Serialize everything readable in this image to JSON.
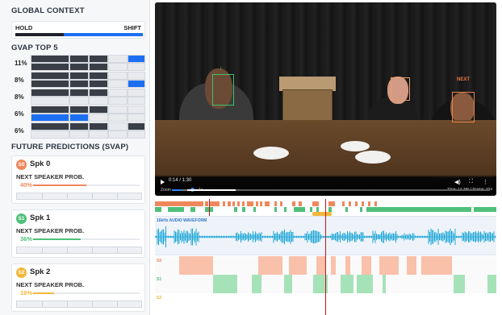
{
  "left_panel": {
    "global_context": {
      "title": "GLOBAL CONTEXT",
      "hold_label": "HOLD",
      "shift_label": "SHIFT",
      "shift_fraction": 0.62
    },
    "gvap": {
      "title": "GVAP TOP 5",
      "rows": [
        {
          "pct": "11%"
        },
        {
          "pct": "8%"
        },
        {
          "pct": "8%"
        },
        {
          "pct": "6%"
        },
        {
          "pct": "6%"
        }
      ]
    },
    "svap": {
      "title": "FUTURE PREDICTIONS (SVAP)",
      "speakers": [
        {
          "badge": "S0",
          "name": "Spk 0",
          "sub": "NEXT SPEAKER PROB.",
          "pct": "40%",
          "value": 0.4,
          "color": "#f0875c"
        },
        {
          "badge": "S1",
          "name": "Spk 1",
          "sub": "NEXT SPEAKER PROB.",
          "pct": "36%",
          "value": 0.36,
          "color": "#4fc07a"
        },
        {
          "badge": "S2",
          "name": "Spk 2",
          "sub": "NEXT SPEAKER PROB.",
          "pct": "16%",
          "value": 0.16,
          "color": "#f2b83a"
        }
      ]
    }
  },
  "video": {
    "time": "0:14 / 1:30",
    "zoom_label": "Zoom",
    "zoom_value": "1x",
    "progress": 0.16,
    "frame_info": "Time: 14.38s | Frame: 332",
    "next_label": "NEXT",
    "arrow_label": "↓"
  },
  "timeline": {
    "waveform_label": "16kHz AUDIO WAVEFORM",
    "lanes": [
      {
        "label": "S0",
        "color": "#f0875c"
      },
      {
        "label": "S1",
        "color": "#4fc07a"
      },
      {
        "label": "S2",
        "color": "#f2b83a"
      }
    ]
  },
  "colors": {
    "accent": "#1d6ff2",
    "s0": "#f0875c",
    "s1": "#4fc07a",
    "s2": "#f2b83a",
    "playhead": "#c4161c"
  }
}
